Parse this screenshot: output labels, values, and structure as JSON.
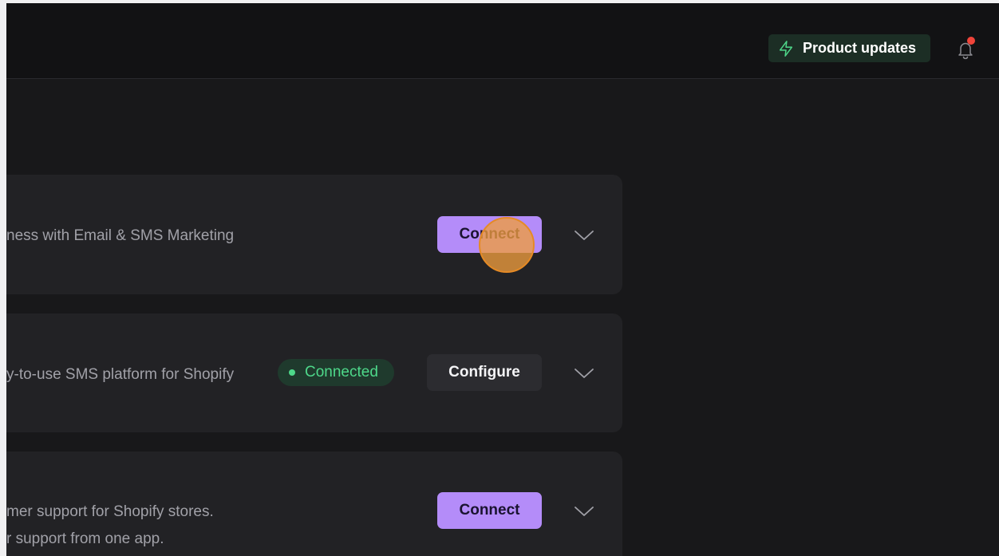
{
  "header": {
    "product_updates_label": "Product updates",
    "notification_dot_color": "#f0443a"
  },
  "integrations": [
    {
      "description_lines": [
        "ness with Email & SMS Marketing"
      ],
      "action_label": "Connect",
      "action_type": "connect"
    },
    {
      "description_lines": [
        "y-to-use SMS platform for Shopify"
      ],
      "status_label": "Connected",
      "action_label": "Configure",
      "action_type": "configure"
    },
    {
      "description_lines": [
        "mer support for Shopify stores.",
        "r support from one app."
      ],
      "action_label": "Connect",
      "action_type": "connect"
    }
  ],
  "colors": {
    "connect_button": "#b48cf9",
    "connected_badge_text": "#4ed88a",
    "product_updates_bg": "#1c2e25"
  }
}
